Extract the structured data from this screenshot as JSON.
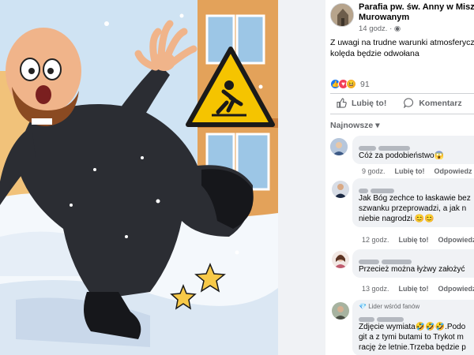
{
  "post": {
    "page_name_line1": "Parafia pw. św. Anny w Miszew",
    "page_name_line2": "Murowanym",
    "time": "14 godz.",
    "text_line1": "Z uwagi na trudne warunki atmosferyczne",
    "text_line2": "kolęda będzie odwołana",
    "reaction_count": "91",
    "like_label": "Lubię to!",
    "comment_label": "Komentarz",
    "sort_label": "Najnowsze"
  },
  "comments": [
    {
      "text": "Cóż za podobieństwo😱",
      "time": "9 godz.",
      "like": "Lubię to!",
      "reply": "Odpowiedz"
    },
    {
      "text_lines": [
        "Jak Bóg zechce to łaskawie bez",
        "szwanku przeprowadzi, a jak n",
        "niebie nagrodzi.😊😊"
      ],
      "time": "12 godz.",
      "like": "Lubię to!",
      "reply": "Odpowiedz"
    },
    {
      "text": "Przecież można łyżwy założyć",
      "time": "13 godz.",
      "like": "Lubię to!",
      "reply": "Odpowiedz"
    },
    {
      "badge": "Lider wśród fanów",
      "text_lines": [
        "Zdjęcie wymiata🤣🤣🤣.Podo",
        "git a z tymi butami to Trykot m",
        "rację że letnie.Trzeba będzie p"
      ]
    }
  ],
  "colors": {
    "accent": "#1877f2",
    "muted": "#65676b",
    "bubble": "#f0f2f5"
  }
}
